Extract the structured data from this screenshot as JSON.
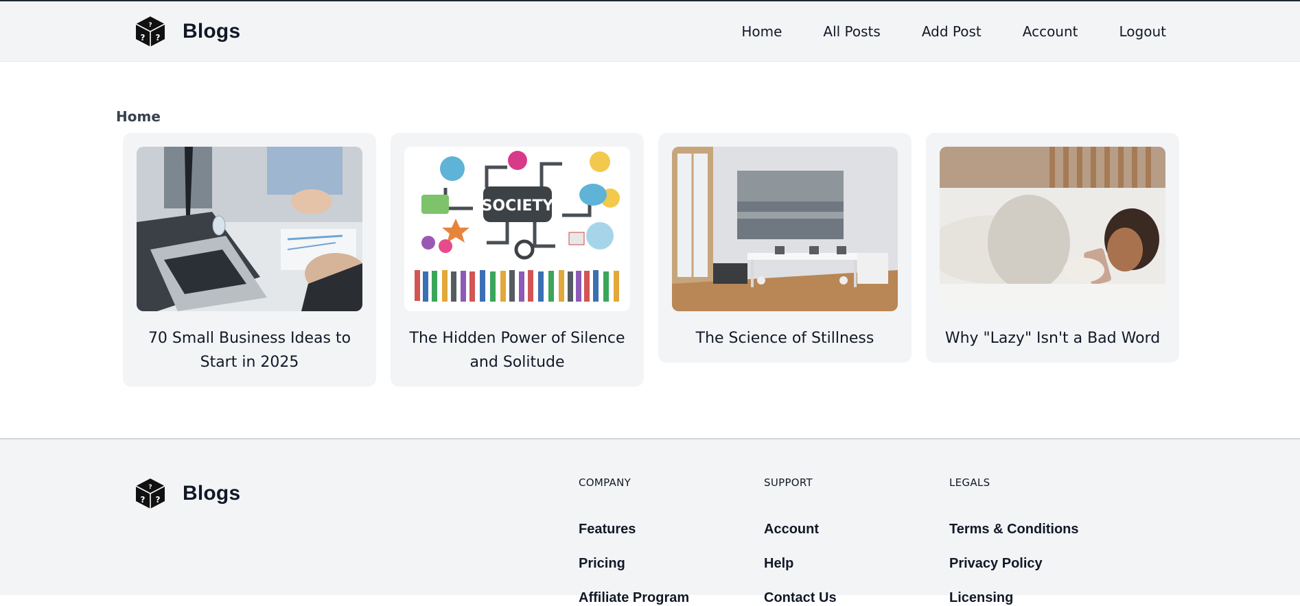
{
  "header": {
    "brand": "Blogs",
    "nav": [
      "Home",
      "All Posts",
      "Add Post",
      "Account",
      "Logout"
    ]
  },
  "breadcrumb": "Home",
  "posts": [
    {
      "title": "70 Small Business Ideas to Start in 2025",
      "image": "office-meeting-laptop"
    },
    {
      "title": "The Hidden Power of Silence and Solitude",
      "image": "society-icons-crowd"
    },
    {
      "title": "The Science of Stillness",
      "image": "empty-office-painting"
    },
    {
      "title": "Why \"Lazy\" Isn't a Bad Word",
      "image": "woman-in-bed-phone"
    }
  ],
  "society_label": "SOCIETY",
  "footer": {
    "brand": "Blogs",
    "columns": [
      {
        "heading": "COMPANY",
        "links": [
          "Features",
          "Pricing",
          "Affiliate Program"
        ]
      },
      {
        "heading": "SUPPORT",
        "links": [
          "Account",
          "Help",
          "Contact Us"
        ]
      },
      {
        "heading": "LEGALS",
        "links": [
          "Terms & Conditions",
          "Privacy Policy",
          "Licensing"
        ]
      }
    ]
  },
  "icons": {
    "logo": "dice-question-icon"
  },
  "colors": {
    "navbar_bg": "#f3f4f6",
    "card_bg": "#f3f4f6",
    "text": "#111827",
    "topbar": "#1f2937"
  }
}
